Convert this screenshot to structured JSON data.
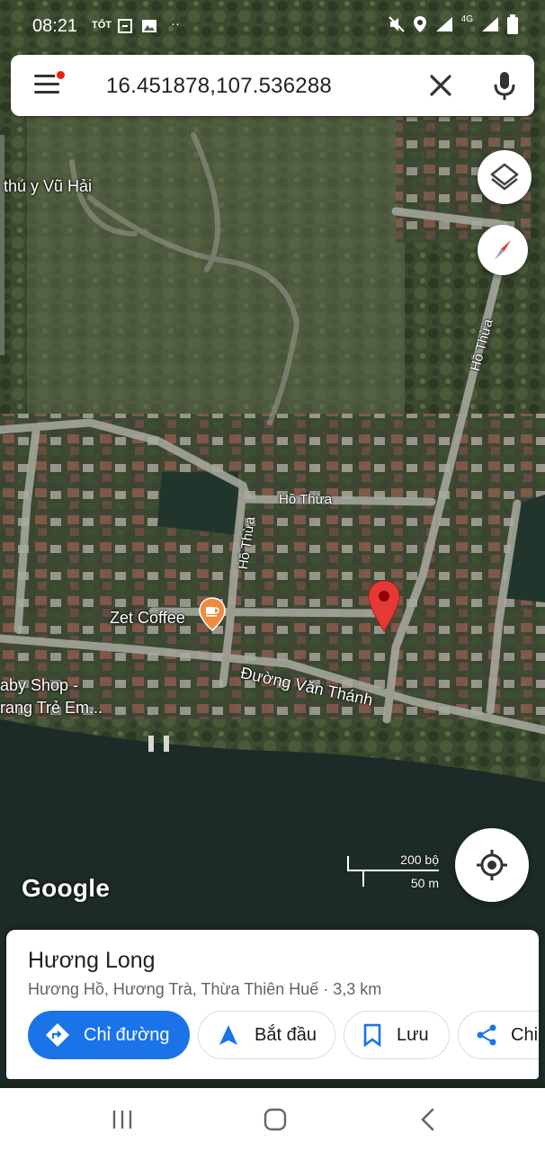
{
  "status_bar": {
    "time": "08:21",
    "carrier_icon": "TỐT",
    "network": "4G"
  },
  "search": {
    "query": "16.451878,107.536288"
  },
  "map_labels": {
    "poi_top": "thú y Vũ Hải",
    "road_ho_thua_vertical_right": "Hồ Thừa",
    "road_ho_thua_horizontal": "Hồ Thừa",
    "road_ho_thua_vertical_mid": "Hồ Thừa",
    "cafe": "Zet Coffee",
    "shop_line1": "aby Shop -",
    "shop_line2": "rang Trẻ Em...",
    "road_main": "Đường Văn Thánh"
  },
  "attribution": "Google",
  "scale": {
    "imperial": "200 bộ",
    "metric": "50 m"
  },
  "place_card": {
    "name": "Hương Long",
    "address": "Hương Hồ, Hương Trà, Thừa Thiên Huế · 3,3 km",
    "buttons": {
      "directions": "Chỉ đường",
      "start": "Bắt đầu",
      "save": "Lưu",
      "share": "Chi"
    }
  },
  "colors": {
    "accent": "#1a73e8",
    "pin": "#e53935",
    "cafe_pin": "#f08a3c"
  },
  "icons": [
    "menu-icon",
    "close-icon",
    "mic-icon",
    "layers-icon",
    "compass-icon",
    "my-location-icon",
    "directions-icon",
    "navigation-icon",
    "bookmark-icon",
    "share-icon",
    "recents-icon",
    "home-icon",
    "back-icon"
  ]
}
